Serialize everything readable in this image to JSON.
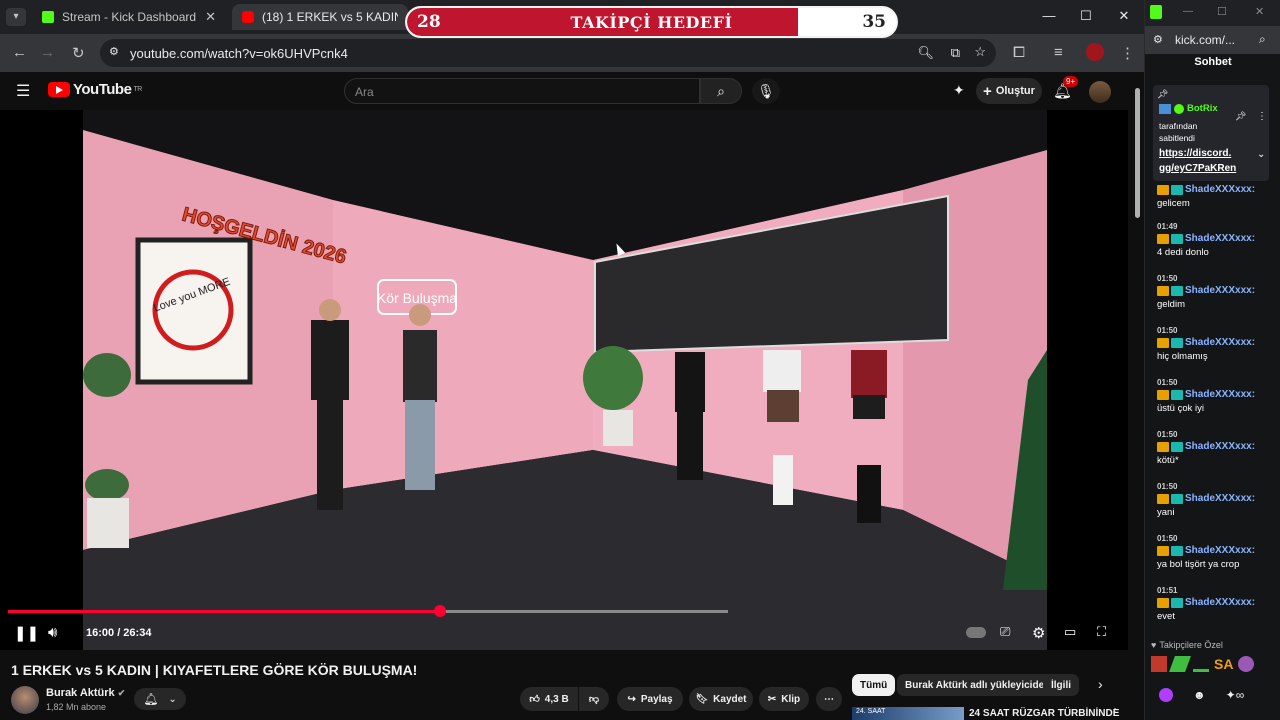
{
  "browser": {
    "tabs": [
      {
        "title": "Stream - Kick Dashboard",
        "active": false,
        "favicon_color": "#53fc18"
      },
      {
        "title": "(18) 1 ERKEK vs 5 KADIN | K",
        "active": true,
        "favicon_color": "#ff0000"
      }
    ],
    "url": "youtube.com/watch?v=ok6UHVPcnk4"
  },
  "goal_overlay": {
    "current": "28",
    "label": "TAKİPÇİ HEDEFİ",
    "target": "35",
    "progress_fraction": 0.8,
    "fill_color": "#c0152e"
  },
  "youtube": {
    "logo_text": "YouTube",
    "logo_region": "TR",
    "search_placeholder": "Ara",
    "create_label": "Oluştur",
    "notif_count": "9+",
    "video": {
      "time": "16:00 / 26:34",
      "progress_fraction": 0.6,
      "scene_text": {
        "welcome_sign": "HOŞGELDİN 2026",
        "poster_text": "Love you MORE",
        "neon_sign": "Kör Buluşma"
      }
    },
    "title": "1 ERKEK vs 5 KADIN | KIYAFETLERE GÖRE KÖR BULUŞMA!",
    "channel": {
      "name": "Burak Aktürk",
      "subs": "1,82 Mn abone"
    },
    "actions": {
      "likes": "4,3 B",
      "share": "Paylaş",
      "save": "Kaydet",
      "clip": "Klip"
    },
    "chips": [
      "Tümü",
      "Burak Aktürk adlı yükleyiciden",
      "İlgili"
    ],
    "recommended": {
      "thumb_text": "24. SAAT",
      "title": "24 SAAT RÜZGAR TÜRBİNİNDE"
    }
  },
  "kick": {
    "url": "kick.com/...",
    "chat_title": "Sohbet",
    "pinned": {
      "user": "BotRix",
      "by": "tarafından sabitlendi",
      "link_line1": "https://discord.",
      "link_line2": "gg/eyC7PaKRen"
    },
    "messages": [
      {
        "time": "",
        "user": "ShadeXXXxxx:",
        "text": "gelicem"
      },
      {
        "time": "01:49",
        "user": "ShadeXXXxxx:",
        "text": "4 dedi donlo"
      },
      {
        "time": "01:50",
        "user": "ShadeXXXxxx:",
        "text": "geldim"
      },
      {
        "time": "01:50",
        "user": "ShadeXXXxxx:",
        "text": "hiç olmamış"
      },
      {
        "time": "01:50",
        "user": "ShadeXXXxxx:",
        "text": "üstü çok iyi"
      },
      {
        "time": "01:50",
        "user": "ShadeXXXxxx:",
        "text": "kötü*"
      },
      {
        "time": "01:50",
        "user": "ShadeXXXxxx:",
        "text": "yani"
      },
      {
        "time": "01:50",
        "user": "ShadeXXXxxx:",
        "text": "ya bol tişört ya crop"
      },
      {
        "time": "01:51",
        "user": "ShadeXXXxxx:",
        "text": "evet"
      }
    ],
    "emotes_label": "Takipçilere Özel",
    "emote_sa": "SA"
  }
}
